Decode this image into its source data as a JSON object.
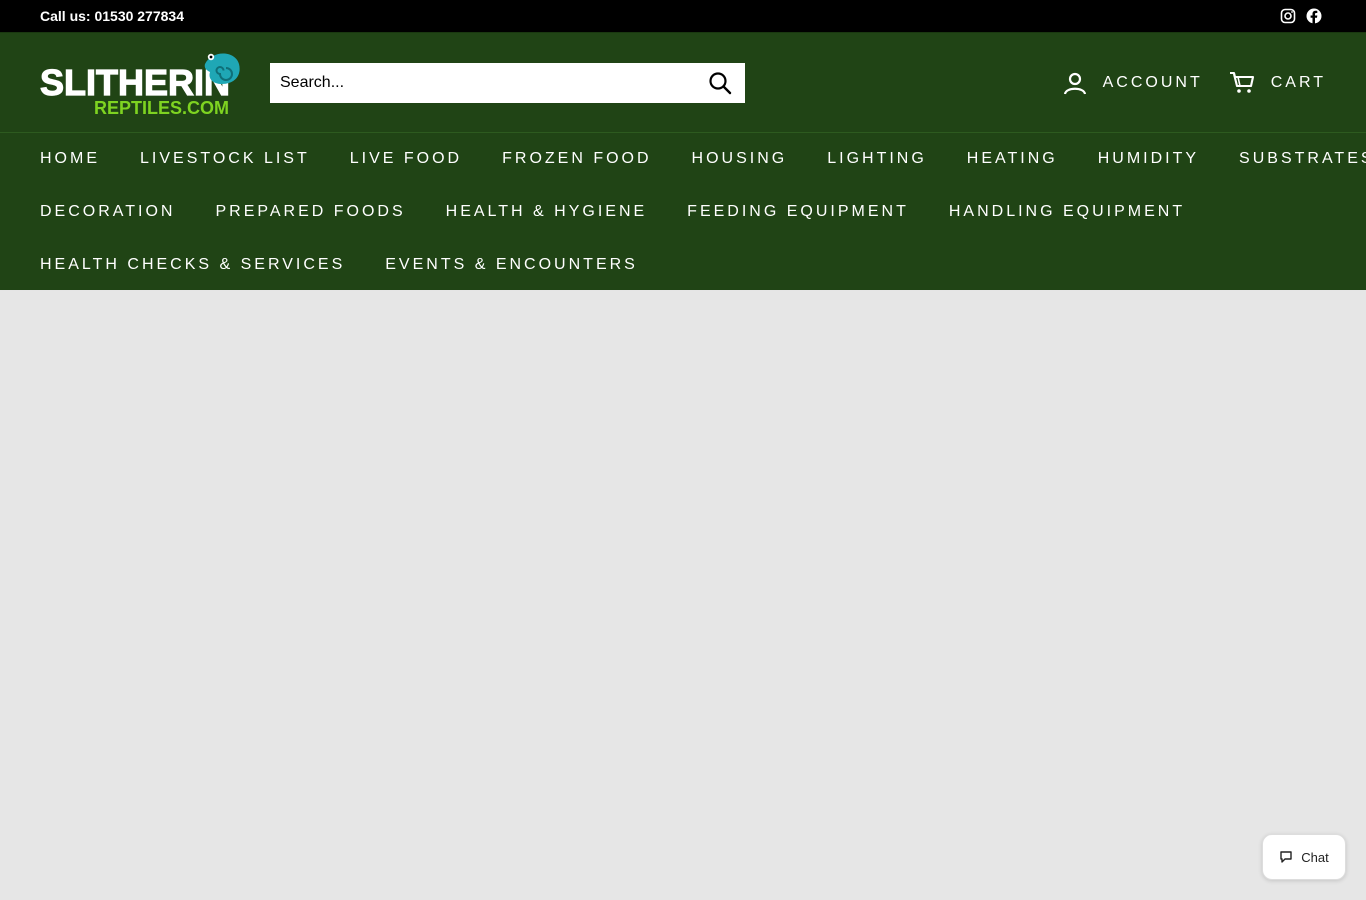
{
  "topbar": {
    "phone": "Call us: 01530 277834",
    "social": [
      "instagram-icon",
      "facebook-icon"
    ]
  },
  "header": {
    "logo_text_top": "SLITHERIN",
    "logo_text_bottom": "REPTILES.COM",
    "search_placeholder": "Search...",
    "account_label": "ACCOUNT",
    "cart_label": "CART"
  },
  "nav": {
    "row1": [
      "HOME",
      "LIVESTOCK LIST",
      "LIVE FOOD",
      "FROZEN FOOD",
      "HOUSING",
      "LIGHTING",
      "HEATING",
      "HUMIDITY",
      "SUBSTRATES"
    ],
    "row2": [
      "DECORATION",
      "PREPARED FOODS",
      "HEALTH & HYGIENE",
      "FEEDING EQUIPMENT",
      "HANDLING EQUIPMENT"
    ],
    "row3": [
      "HEALTH CHECKS & SERVICES",
      "EVENTS & ENCOUNTERS"
    ]
  },
  "chat": {
    "label": "Chat"
  },
  "colors": {
    "header_bg": "#204415",
    "topbar_bg": "#000000",
    "logo_green": "#7ed321",
    "logo_teal": "#1fa7b5"
  }
}
